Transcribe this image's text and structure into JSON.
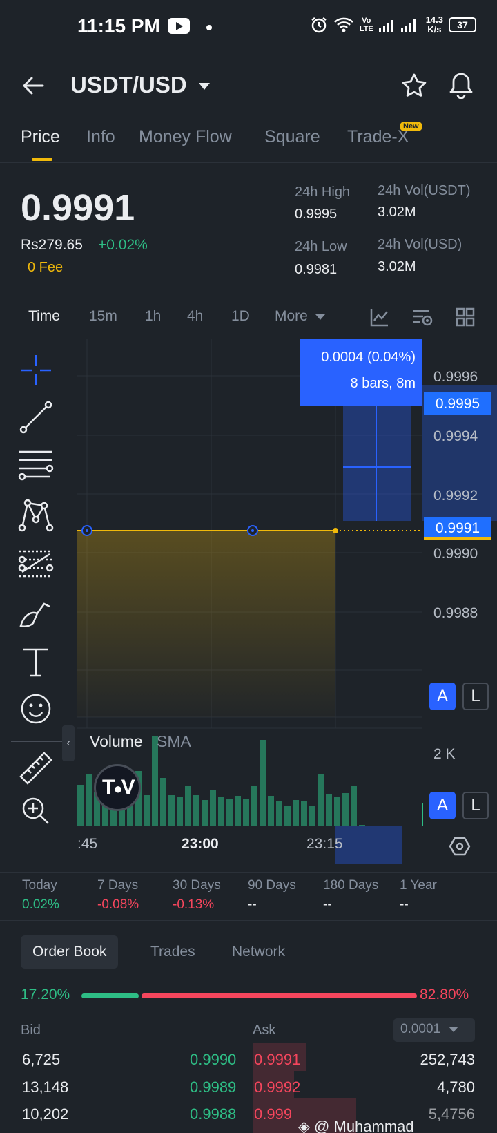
{
  "status_bar": {
    "time": "11:15 PM",
    "network_speed": "14.3",
    "network_speed_unit": "K/s",
    "battery": "37",
    "net_type": "Vo",
    "net_type2": "LTE"
  },
  "header": {
    "pair": "USDT/USD"
  },
  "tabs": [
    {
      "label": "Price"
    },
    {
      "label": "Info"
    },
    {
      "label": "Money Flow"
    },
    {
      "label": "Square"
    },
    {
      "label": "Trade-X",
      "badge": "New"
    }
  ],
  "ticker": {
    "last_price": "0.9991",
    "local_price": "Rs279.65",
    "change": "+0.02%",
    "fee": "0 Fee",
    "high_label": "24h High",
    "high_value": "0.9995",
    "low_label": "24h Low",
    "low_value": "0.9981",
    "vol_usdt_label": "24h Vol(USDT)",
    "vol_usdt_value": "3.02M",
    "vol_usd_label": "24h Vol(USD)",
    "vol_usd_value": "3.02M"
  },
  "timeframes": [
    "Time",
    "15m",
    "1h",
    "4h",
    "1D",
    "More"
  ],
  "chart": {
    "price_labels": [
      "0.9996",
      "0.9994",
      "0.9992",
      "0.9990",
      "0.9988"
    ],
    "current_tag": "0.9991",
    "high_tag": "0.9995",
    "measure_change": "0.0004 (0.04%)",
    "measure_bars": "8 bars, 8m",
    "volume_title": "Volume",
    "volume_sma": "SMA",
    "volume_axis": "2 K",
    "btn_a": "A",
    "btn_l": "L",
    "time_labels": [
      ":45",
      "23:00",
      "23:15"
    ],
    "colors": {
      "line": "#f0b90b",
      "up": "#2ebd85",
      "tooltip": "#2962ff"
    }
  },
  "performance": [
    {
      "label": "Today",
      "value": "0.02%",
      "color": "#2ebd85"
    },
    {
      "label": "7 Days",
      "value": "-0.08%",
      "color": "#f6465d"
    },
    {
      "label": "30 Days",
      "value": "-0.13%",
      "color": "#f6465d"
    },
    {
      "label": "90 Days",
      "value": "--",
      "color": "#eaecef"
    },
    {
      "label": "180 Days",
      "value": "--",
      "color": "#eaecef"
    },
    {
      "label": "1 Year",
      "value": "--",
      "color": "#eaecef"
    }
  ],
  "order_book_tabs": [
    "Order Book",
    "Trades",
    "Network"
  ],
  "order_book": {
    "bid_ratio": "17.20%",
    "ask_ratio": "82.80%",
    "bid_fraction": 0.172,
    "bid_label": "Bid",
    "ask_label": "Ask",
    "precision": "0.0001",
    "rows": [
      {
        "bid_qty": "6,725",
        "bid_price": "0.9990",
        "ask_price": "0.9991",
        "ask_qty": "252,743"
      },
      {
        "bid_qty": "13,148",
        "bid_price": "0.9989",
        "ask_price": "0.9992",
        "ask_qty": "4,780"
      },
      {
        "bid_qty": "10,202",
        "bid_price": "0.9988",
        "ask_price": "0.999",
        "ask_qty": "5,4756"
      }
    ]
  },
  "watermark": "@ Muhammad"
}
